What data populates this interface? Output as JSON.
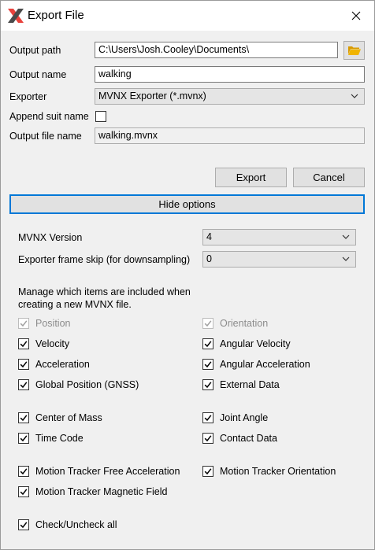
{
  "window": {
    "title": "Export File"
  },
  "form": {
    "output_path_label": "Output path",
    "output_path_value": "C:\\Users\\Josh.Cooley\\Documents\\",
    "output_name_label": "Output name",
    "output_name_value": "walking",
    "exporter_label": "Exporter",
    "exporter_value": "MVNX Exporter (*.mvnx)",
    "append_suit_label": "Append suit name",
    "append_suit_checked": false,
    "output_file_label": "Output file name",
    "output_file_value": "walking.mvnx"
  },
  "buttons": {
    "export": "Export",
    "cancel": "Cancel",
    "hide_options": "Hide options"
  },
  "options": {
    "version_label": "MVNX Version",
    "version_value": "4",
    "frame_skip_label": "Exporter frame skip (for downsampling)",
    "frame_skip_value": "0",
    "manage_text_line1": "Manage which items are included when",
    "manage_text_line2": "creating a new MVNX file."
  },
  "items": [
    {
      "label": "Position",
      "checked": true,
      "disabled": true
    },
    {
      "label": "Orientation",
      "checked": true,
      "disabled": true
    },
    {
      "label": "Velocity",
      "checked": true,
      "disabled": false
    },
    {
      "label": "Angular Velocity",
      "checked": true,
      "disabled": false
    },
    {
      "label": "Acceleration",
      "checked": true,
      "disabled": false
    },
    {
      "label": "Angular Acceleration",
      "checked": true,
      "disabled": false
    },
    {
      "label": "Global Position (GNSS)",
      "checked": true,
      "disabled": false
    },
    {
      "label": "External Data",
      "checked": true,
      "disabled": false
    },
    {
      "label": "Center of Mass",
      "checked": true,
      "disabled": false
    },
    {
      "label": "Joint Angle",
      "checked": true,
      "disabled": false
    },
    {
      "label": "Time Code",
      "checked": true,
      "disabled": false
    },
    {
      "label": "Contact Data",
      "checked": true,
      "disabled": false
    },
    {
      "label": "Motion Tracker Free Acceleration",
      "checked": true,
      "disabled": false
    },
    {
      "label": "Motion Tracker Orientation",
      "checked": true,
      "disabled": false
    },
    {
      "label": "Motion Tracker Magnetic Field",
      "checked": true,
      "disabled": false
    },
    {
      "label": "Check/Uncheck all",
      "checked": true,
      "disabled": false
    }
  ],
  "icons": {
    "app": "xsens-logo-icon",
    "close": "close-icon",
    "folder": "folder-icon",
    "dropdown": "chevron-down-icon",
    "check": "checkmark-icon"
  },
  "colors": {
    "accent": "#0078d7",
    "logo_red": "#e8423c",
    "folder": "#f0b400"
  }
}
